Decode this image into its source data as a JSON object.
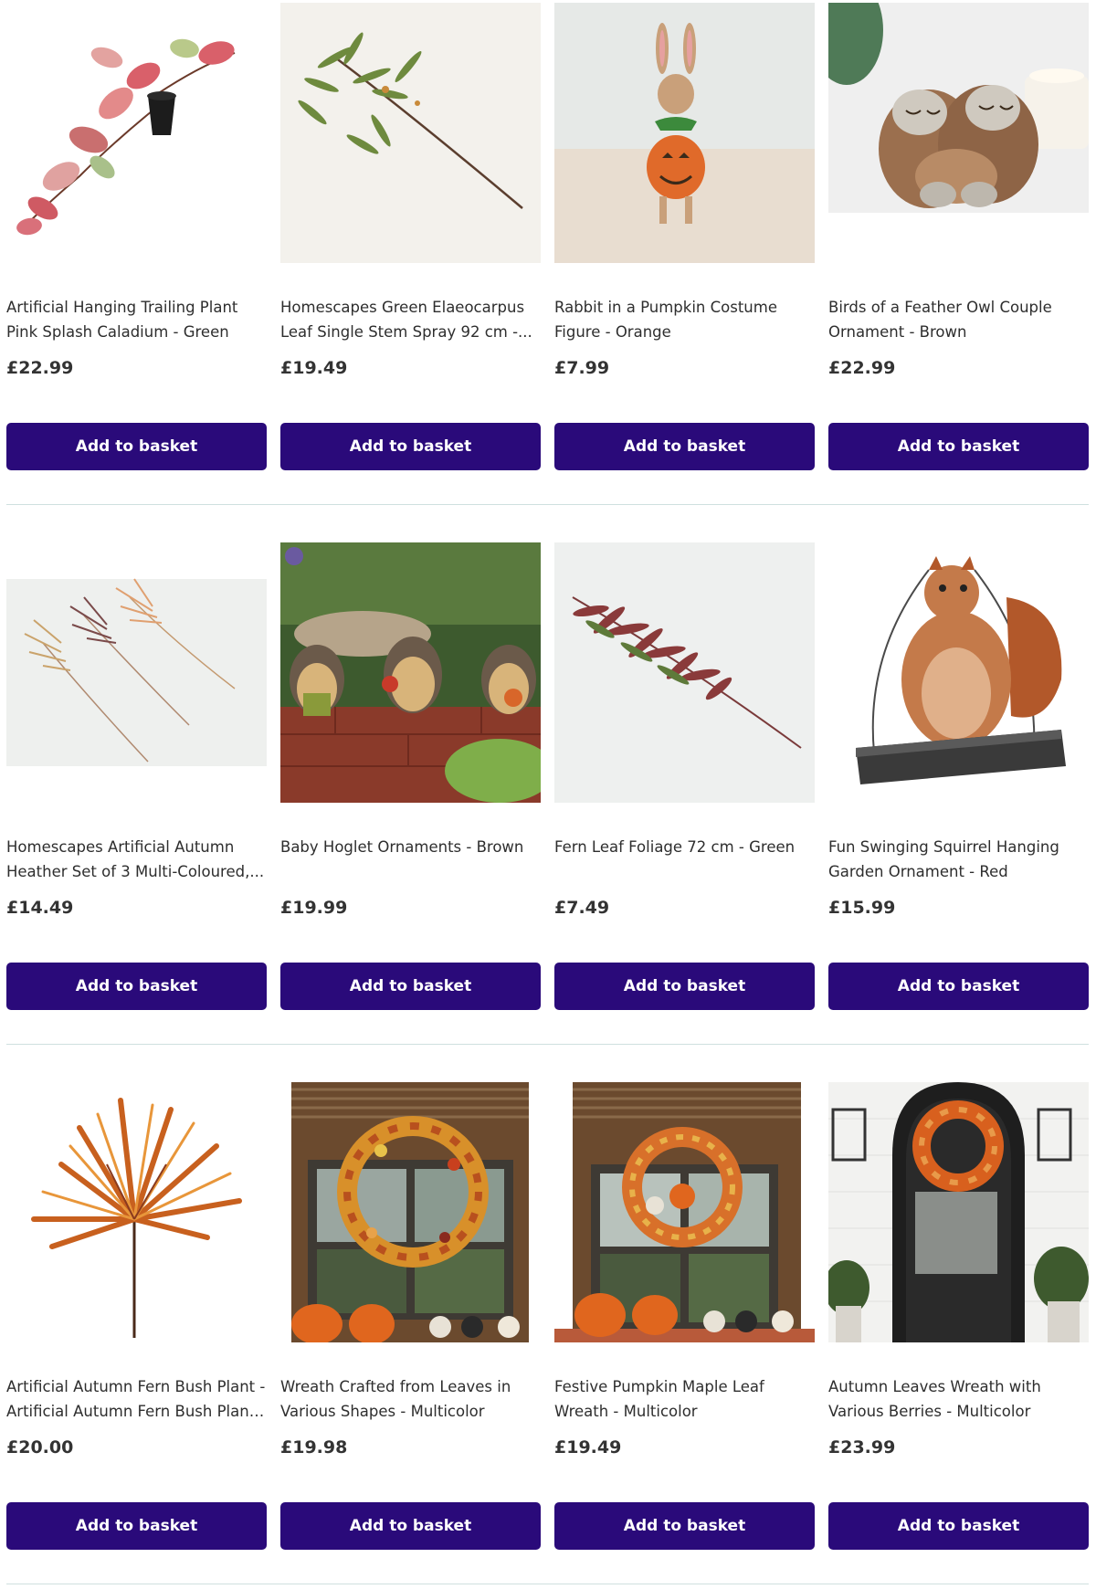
{
  "products": [
    {
      "title": "Artificial Hanging Trailing Plant Pink Splash Caladium - Green",
      "display_title": "Artificial Hanging Trailing Plant Pink Splash Caladium - Green",
      "price": "£22.99",
      "button": "Add to basket"
    },
    {
      "title": "Homescapes Green Elaeocarpus Leaf Single Stem Spray 92 cm -...",
      "display_title": "Homescapes Green Elaeocarpus Leaf Single Stem Spray 92 cm -...",
      "price": "£19.49",
      "button": "Add to basket"
    },
    {
      "title": "Rabbit in a Pumpkin Costume Figure - Orange",
      "display_title": "Rabbit in a Pumpkin Costume Figure - Orange",
      "price": "£7.99",
      "button": "Add to basket"
    },
    {
      "title": "Birds of a Feather Owl Couple Ornament - Brown",
      "display_title": "Birds of a Feather Owl Couple Ornament - Brown",
      "price": "£22.99",
      "button": "Add to basket"
    },
    {
      "title": "Homescapes Artificial Autumn Heather Set of 3 Multi-Coloured,...",
      "display_title": "Homescapes Artificial Autumn Heather Set of 3 Multi-Coloured,...",
      "price": "£14.49",
      "button": "Add to basket"
    },
    {
      "title": "Baby Hoglet Ornaments - Brown",
      "display_title": "Baby Hoglet Ornaments - Brown",
      "price": "£19.99",
      "button": "Add to basket"
    },
    {
      "title": "Fern Leaf Foliage 72 cm - Green",
      "display_title": "Fern Leaf Foliage 72 cm - Green",
      "price": "£7.49",
      "button": "Add to basket"
    },
    {
      "title": "Fun Swinging Squirrel Hanging Garden Ornament - Red",
      "display_title": "Fun Swinging Squirrel Hanging Garden Ornament - Red",
      "price": "£15.99",
      "button": "Add to basket"
    },
    {
      "title": "Artificial Autumn Fern Bush Plant - Artificial Autumn Fern Bush Plant ...",
      "display_title": "Artificial Autumn Fern Bush Plant - Artificial Autumn Fern Bush Plant ...",
      "price": "£20.00",
      "button": "Add to basket"
    },
    {
      "title": "Wreath Crafted from Leaves in Various Shapes - Multicolor",
      "display_title": "Wreath Crafted from Leaves in Various Shapes - Multicolor",
      "price": "£19.98",
      "button": "Add to basket"
    },
    {
      "title": "Festive Pumpkin Maple Leaf Wreath - Multicolor",
      "display_title": "Festive Pumpkin Maple Leaf Wreath - Multicolor",
      "price": "£19.49",
      "button": "Add to basket"
    },
    {
      "title": "Autumn Leaves Wreath with Various Berries - Multicolor",
      "display_title": "Autumn Leaves Wreath with Various Berries - Multicolor",
      "price": "£23.99",
      "button": "Add to basket"
    }
  ],
  "colors": {
    "button_bg": "#2a0a7a",
    "button_text": "#ffffff",
    "divider": "#cfe0df"
  }
}
